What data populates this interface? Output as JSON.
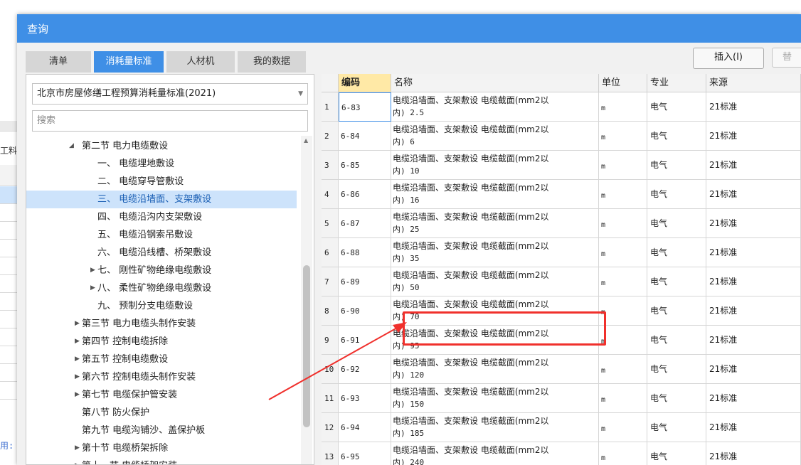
{
  "background": {
    "labels": [
      "工料",
      "用:"
    ]
  },
  "dialog": {
    "title": "查询",
    "tabs": [
      {
        "label": "清单",
        "active": false
      },
      {
        "label": "消耗量标准",
        "active": true
      },
      {
        "label": "人材机",
        "active": false
      },
      {
        "label": "我的数据",
        "active": false
      }
    ],
    "insert_label": "插入(I)",
    "replace_label": "替"
  },
  "left": {
    "standard": "北京市房屋修缮工程预算消耗量标准(2021)",
    "search_placeholder": "搜索",
    "tree": [
      {
        "label": "第二节 电力电缆敷设",
        "level": 1,
        "expander": "expanded",
        "selected": false
      },
      {
        "label": "一、 电缆埋地敷设",
        "level": 2,
        "expander": "",
        "selected": false
      },
      {
        "label": "二、 电缆穿导管敷设",
        "level": 2,
        "expander": "",
        "selected": false
      },
      {
        "label": "三、 电缆沿墙面、支架敷设",
        "level": 2,
        "expander": "",
        "selected": true
      },
      {
        "label": "四、 电缆沿沟内支架敷设",
        "level": 2,
        "expander": "",
        "selected": false
      },
      {
        "label": "五、 电缆沿钢索吊敷设",
        "level": 2,
        "expander": "",
        "selected": false
      },
      {
        "label": "六、 电缆沿线槽、桥架敷设",
        "level": 2,
        "expander": "",
        "selected": false
      },
      {
        "label": "七、 刚性矿物绝缘电缆敷设",
        "level": 2,
        "expander": "collapsed",
        "selected": false
      },
      {
        "label": "八、 柔性矿物绝缘电缆敷设",
        "level": 2,
        "expander": "collapsed",
        "selected": false
      },
      {
        "label": "九、 预制分支电缆敷设",
        "level": 2,
        "expander": "",
        "selected": false
      },
      {
        "label": "第三节 电力电缆头制作安装",
        "level": 0,
        "expander": "collapsed",
        "selected": false
      },
      {
        "label": "第四节 控制电缆拆除",
        "level": 0,
        "expander": "collapsed",
        "selected": false
      },
      {
        "label": "第五节 控制电缆敷设",
        "level": 0,
        "expander": "collapsed",
        "selected": false
      },
      {
        "label": "第六节 控制电缆头制作安装",
        "level": 0,
        "expander": "collapsed",
        "selected": false
      },
      {
        "label": "第七节 电缆保护管安装",
        "level": 0,
        "expander": "collapsed",
        "selected": false
      },
      {
        "label": "第八节 防火保护",
        "level": 0,
        "expander": "",
        "selected": false
      },
      {
        "label": "第九节 电缆沟铺沙、盖保护板",
        "level": 0,
        "expander": "",
        "selected": false
      },
      {
        "label": "第十节 电缆桥架拆除",
        "level": 0,
        "expander": "collapsed",
        "selected": false
      },
      {
        "label": "第十一节 电缆桥架安装",
        "level": 0,
        "expander": "collapsed",
        "selected": false
      }
    ]
  },
  "table": {
    "headers": {
      "code": "编码",
      "name": "名称",
      "unit": "单位",
      "spec": "专业",
      "source": "来源"
    },
    "rows": [
      {
        "idx": "1",
        "code": "6-83",
        "name1": "电缆沿墙面、支架敷设 电缆截面(mm2以",
        "name2": "内) 2.5",
        "unit": "m",
        "spec": "电气",
        "source": "21标准"
      },
      {
        "idx": "2",
        "code": "6-84",
        "name1": "电缆沿墙面、支架敷设 电缆截面(mm2以",
        "name2": "内) 6",
        "unit": "m",
        "spec": "电气",
        "source": "21标准"
      },
      {
        "idx": "3",
        "code": "6-85",
        "name1": "电缆沿墙面、支架敷设 电缆截面(mm2以",
        "name2": "内) 10",
        "unit": "m",
        "spec": "电气",
        "source": "21标准"
      },
      {
        "idx": "4",
        "code": "6-86",
        "name1": "电缆沿墙面、支架敷设 电缆截面(mm2以",
        "name2": "内) 16",
        "unit": "m",
        "spec": "电气",
        "source": "21标准"
      },
      {
        "idx": "5",
        "code": "6-87",
        "name1": "电缆沿墙面、支架敷设 电缆截面(mm2以",
        "name2": "内) 25",
        "unit": "m",
        "spec": "电气",
        "source": "21标准"
      },
      {
        "idx": "6",
        "code": "6-88",
        "name1": "电缆沿墙面、支架敷设 电缆截面(mm2以",
        "name2": "内) 35",
        "unit": "m",
        "spec": "电气",
        "source": "21标准"
      },
      {
        "idx": "7",
        "code": "6-89",
        "name1": "电缆沿墙面、支架敷设 电缆截面(mm2以",
        "name2": "内) 50",
        "unit": "m",
        "spec": "电气",
        "source": "21标准"
      },
      {
        "idx": "8",
        "code": "6-90",
        "name1": "电缆沿墙面、支架敷设 电缆截面(mm2以",
        "name2": "内) 70",
        "unit": "m",
        "spec": "电气",
        "source": "21标准"
      },
      {
        "idx": "9",
        "code": "6-91",
        "name1": "电缆沿墙面、支架敷设 电缆截面(mm2以",
        "name2": "内) 95",
        "unit": "m",
        "spec": "电气",
        "source": "21标准"
      },
      {
        "idx": "10",
        "code": "6-92",
        "name1": "电缆沿墙面、支架敷设 电缆截面(mm2以",
        "name2": "内) 120",
        "unit": "m",
        "spec": "电气",
        "source": "21标准"
      },
      {
        "idx": "11",
        "code": "6-93",
        "name1": "电缆沿墙面、支架敷设 电缆截面(mm2以",
        "name2": "内) 150",
        "unit": "m",
        "spec": "电气",
        "source": "21标准"
      },
      {
        "idx": "12",
        "code": "6-94",
        "name1": "电缆沿墙面、支架敷设 电缆截面(mm2以",
        "name2": "内) 185",
        "unit": "m",
        "spec": "电气",
        "source": "21标准"
      },
      {
        "idx": "13",
        "code": "6-95",
        "name1": "电缆沿墙面、支架敷设 电缆截面(mm2以",
        "name2": "内) 240",
        "unit": "m",
        "spec": "电气",
        "source": "21标准"
      }
    ]
  },
  "colors": {
    "accent": "#3f8fe6",
    "highlight": "#f0302c",
    "selected_row": "#cde3fb",
    "code_header": "#ffe9a6"
  }
}
